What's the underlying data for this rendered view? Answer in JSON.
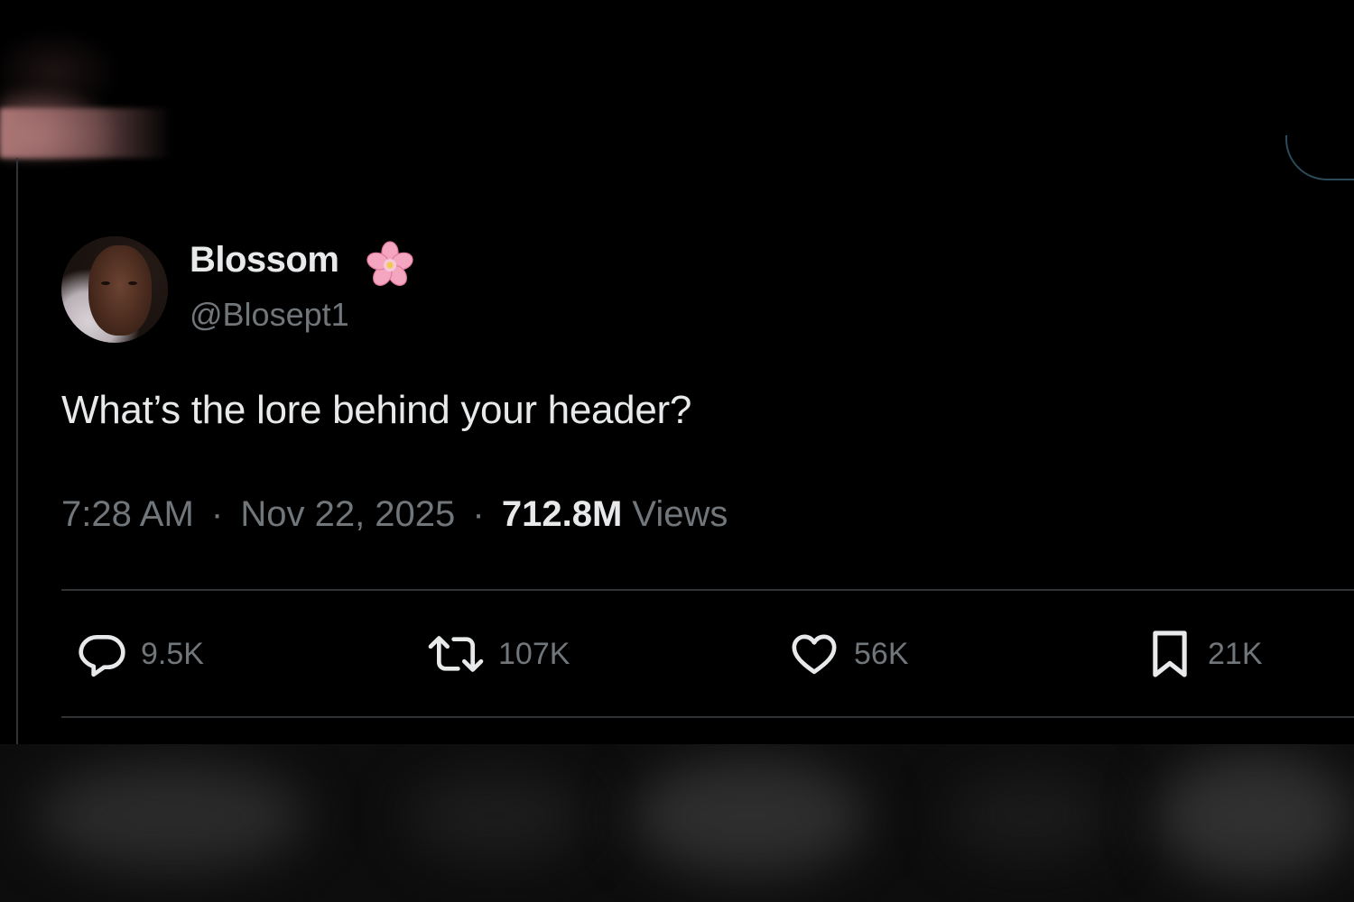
{
  "tweet": {
    "display_name": "Blossom",
    "handle": "@Blosept1",
    "text": "What’s the lore behind your header?",
    "time": "7:28 AM",
    "separator": "·",
    "date": "Nov 22, 2025",
    "views_count": "712.8M",
    "views_label": "Views",
    "name_badge_icon": "cherry-blossom-icon"
  },
  "actions": {
    "replies": "9.5K",
    "reposts": "107K",
    "likes": "56K",
    "bookmarks": "21K"
  },
  "colors": {
    "background": "#000000",
    "primary_text": "#e7e9ea",
    "secondary_text": "#71767b",
    "divider": "#2f3336"
  }
}
